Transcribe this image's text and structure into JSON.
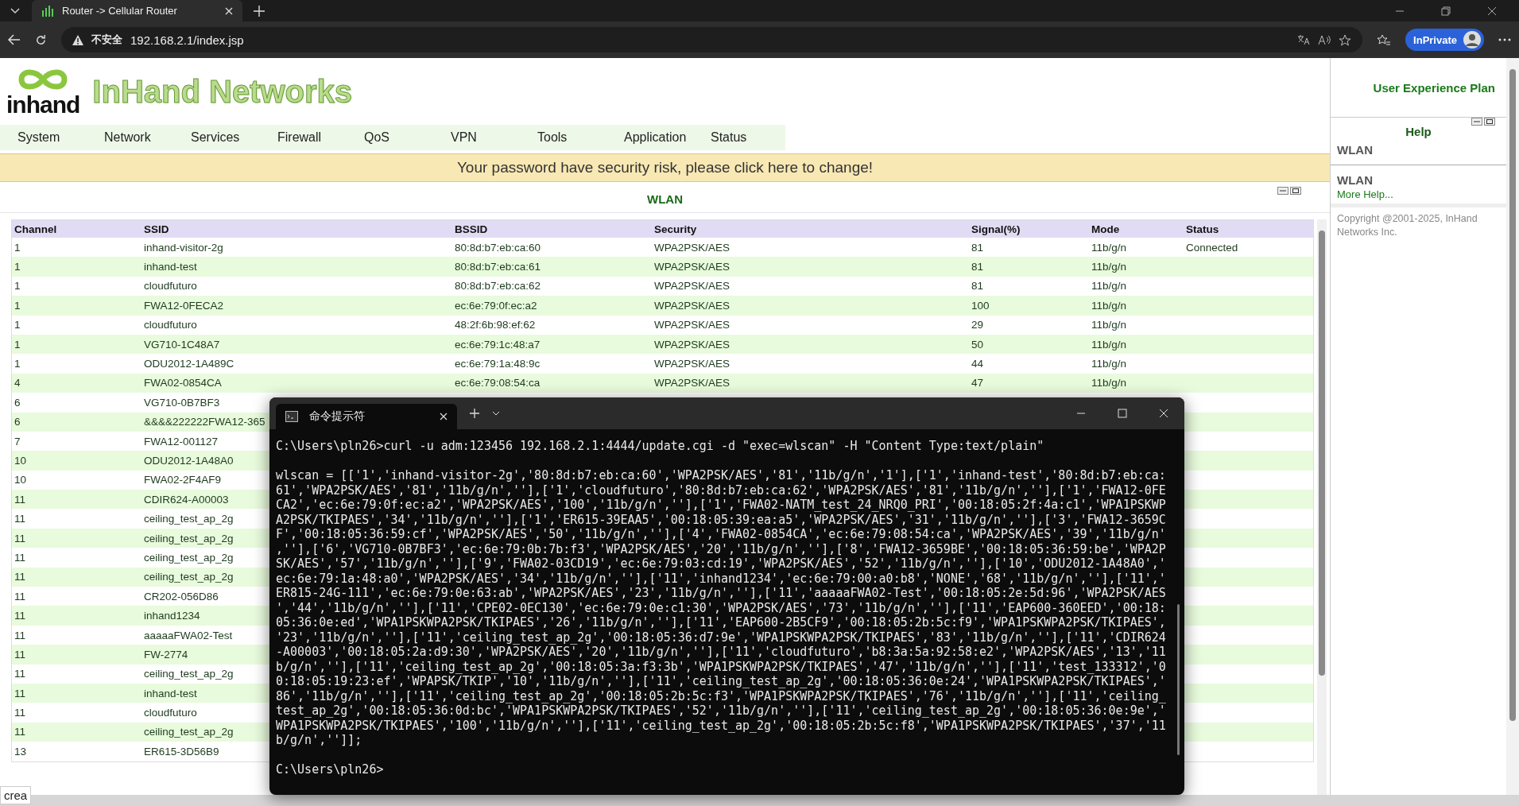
{
  "browser": {
    "tab_title": "Router -> Cellular Router",
    "security_label": "不安全",
    "url": "192.168.2.1/index.jsp",
    "profile_label": "InPrivate"
  },
  "header": {
    "logo_text": "inhand",
    "brand": "InHand Networks"
  },
  "nav": [
    "System",
    "Network",
    "Services",
    "Firewall",
    "QoS",
    "VPN",
    "Tools",
    "Application",
    "Status"
  ],
  "banner": "Your password have security risk, please click here to change!",
  "panel": {
    "title": "WLAN",
    "table": {
      "columns": [
        "Channel",
        "SSID",
        "BSSID",
        "Security",
        "Signal(%)",
        "Mode",
        "Status"
      ],
      "rows": [
        [
          "1",
          "inhand-visitor-2g",
          "80:8d:b7:eb:ca:60",
          "WPA2PSK/AES",
          "81",
          "11b/g/n",
          "Connected"
        ],
        [
          "1",
          "inhand-test",
          "80:8d:b7:eb:ca:61",
          "WPA2PSK/AES",
          "81",
          "11b/g/n"
        ],
        [
          "1",
          "cloudfuturo",
          "80:8d:b7:eb:ca:62",
          "WPA2PSK/AES",
          "81",
          "11b/g/n"
        ],
        [
          "1",
          "FWA12-0FECA2",
          "ec:6e:79:0f:ec:a2",
          "WPA2PSK/AES",
          "100",
          "11b/g/n"
        ],
        [
          "1",
          "cloudfuturo",
          "48:2f:6b:98:ef:62",
          "WPA2PSK/AES",
          "29",
          "11b/g/n"
        ],
        [
          "1",
          "VG710-1C48A7",
          "ec:6e:79:1c:48:a7",
          "WPA2PSK/AES",
          "50",
          "11b/g/n"
        ],
        [
          "1",
          "ODU2012-1A489C",
          "ec:6e:79:1a:48:9c",
          "WPA2PSK/AES",
          "44",
          "11b/g/n"
        ],
        [
          "4",
          "FWA02-0854CA",
          "ec:6e:79:08:54:ca",
          "WPA2PSK/AES",
          "47",
          "11b/g/n"
        ],
        [
          "6",
          "VG710-0B7BF3"
        ],
        [
          "6",
          "&&&&222222FWA12-365"
        ],
        [
          "7",
          "FWA12-001127"
        ],
        [
          "10",
          "ODU2012-1A48A0"
        ],
        [
          "10",
          "FWA02-2F4AF9"
        ],
        [
          "11",
          "CDIR624-A00003"
        ],
        [
          "11",
          "ceiling_test_ap_2g"
        ],
        [
          "11",
          "ceiling_test_ap_2g"
        ],
        [
          "11",
          "ceiling_test_ap_2g"
        ],
        [
          "11",
          "ceiling_test_ap_2g"
        ],
        [
          "11",
          "CR202-056D86"
        ],
        [
          "11",
          "inhand1234"
        ],
        [
          "11",
          "aaaaaFWA02-Test"
        ],
        [
          "11",
          "FW-2774"
        ],
        [
          "11",
          "ceiling_test_ap_2g"
        ],
        [
          "11",
          "inhand-test"
        ],
        [
          "11",
          "cloudfuturo"
        ],
        [
          "11",
          "ceiling_test_ap_2g"
        ],
        [
          "13",
          "ER615-3D56B9"
        ]
      ]
    }
  },
  "sidebar": {
    "top_link": "User Experience Plan",
    "help_title": "Help",
    "help_topic": "WLAN",
    "section_title": "WLAN",
    "more_link": "More Help...",
    "copyright": "Copyright @2001-2025, InHand Networks Inc."
  },
  "tooltip": "crea",
  "terminal": {
    "tab_title": "命令提示符",
    "blocks": [
      [
        "C:\\Users\\pln26>curl -u adm:123456 192.168.2.1:4444/update.cgi -d \"exec=wlscan\" -H \"Content Type:text/plain\""
      ],
      [
        "wlscan = [['1','inhand-visitor-2g','80:8d:b7:eb:ca:60','WPA2PSK/AES','81','11b/g/n','1'],['1','inhand-test','80:8d:b7:eb:ca:",
        "61','WPA2PSK/AES','81','11b/g/n',''],['1','cloudfuturo','80:8d:b7:eb:ca:62','WPA2PSK/AES','81','11b/g/n',''],['1','FWA12-0FE",
        "CA2','ec:6e:79:0f:ec:a2','WPA2PSK/AES','100','11b/g/n',''],['1','FWA02-NATM_test_24_NRQ0_PRI','00:18:05:2f:4a:c1','WPA1PSKWP",
        "A2PSK/TKIPAES','34','11b/g/n',''],['1','ER615-39EAA5','00:18:05:39:ea:a5','WPA2PSK/AES','31','11b/g/n',''],['3','FWA12-3659C",
        "F','00:18:05:36:59:cf','WPA2PSK/AES','50','11b/g/n',''],['4','FWA02-0854CA','ec:6e:79:08:54:ca','WPA2PSK/AES','39','11b/g/n'",
        ",''],['6','VG710-0B7BF3','ec:6e:79:0b:7b:f3','WPA2PSK/AES','20','11b/g/n',''],['8','FWA12-3659BE','00:18:05:36:59:be','WPA2P",
        "SK/AES','57','11b/g/n',''],['9','FWA02-03CD19','ec:6e:79:03:cd:19','WPA2PSK/AES','52','11b/g/n',''],['10','ODU2012-1A48A0','",
        "ec:6e:79:1a:48:a0','WPA2PSK/AES','34','11b/g/n',''],['11','inhand1234','ec:6e:79:00:a0:b8','NONE','68','11b/g/n',''],['11','",
        "ER815-24G-111','ec:6e:79:0e:63:ab','WPA2PSK/AES','23','11b/g/n',''],['11','aaaaaFWA02-Test','00:18:05:2e:5d:96','WPA2PSK/AES",
        "','44','11b/g/n',''],['11','CPE02-0EC130','ec:6e:79:0e:c1:30','WPA2PSK/AES','73','11b/g/n',''],['11','EAP600-360EED','00:18:",
        "05:36:0e:ed','WPA1PSKWPA2PSK/TKIPAES','26','11b/g/n',''],['11','EAP600-2B5CF9','00:18:05:2b:5c:f9','WPA1PSKWPA2PSK/TKIPAES',",
        "'23','11b/g/n',''],['11','ceiling_test_ap_2g','00:18:05:36:d7:9e','WPA1PSKWPA2PSK/TKIPAES','83','11b/g/n',''],['11','CDIR624",
        "-A00003','00:18:05:2a:d9:30','WPA2PSK/AES','20','11b/g/n',''],['11','cloudfuturo','b8:3a:5a:92:58:e2','WPA2PSK/AES','13','11",
        "b/g/n',''],['11','ceiling_test_ap_2g','00:18:05:3a:f3:3b','WPA1PSKWPA2PSK/TKIPAES','47','11b/g/n',''],['11','test_133312','0",
        "0:18:05:19:23:ef','WPAPSK/TKIP','10','11b/g/n',''],['11','ceiling_test_ap_2g','00:18:05:36:0e:24','WPA1PSKWPA2PSK/TKIPAES','",
        "86','11b/g/n',''],['11','ceiling_test_ap_2g','00:18:05:2b:5c:f3','WPA1PSKWPA2PSK/TKIPAES','76','11b/g/n',''],['11','ceiling_",
        "test_ap_2g','00:18:05:36:0d:bc','WPA1PSKWPA2PSK/TKIPAES','52','11b/g/n',''],['11','ceiling_test_ap_2g','00:18:05:36:0e:9e','",
        "WPA1PSKWPA2PSK/TKIPAES','100','11b/g/n',''],['11','ceiling_test_ap_2g','00:18:05:2b:5c:f8','WPA1PSKWPA2PSK/TKIPAES','37','11",
        "b/g/n','']];"
      ],
      [
        "C:\\Users\\pln26>"
      ]
    ]
  }
}
